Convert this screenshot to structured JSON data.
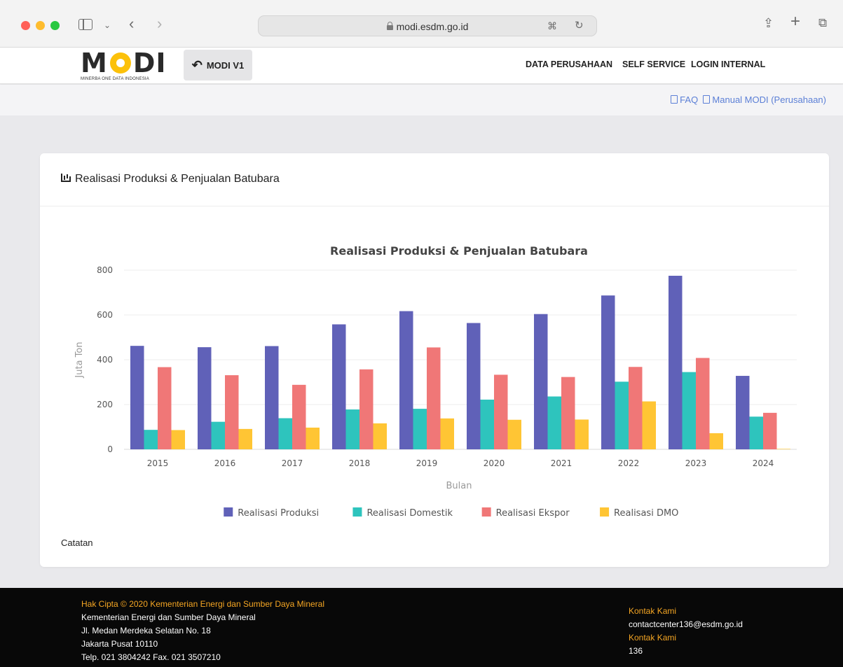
{
  "browser": {
    "url": "modi.esdm.go.id"
  },
  "header": {
    "logo_text": "MODI",
    "logo_subtitle": "MINERBA ONE DATA INDONESIA",
    "modi_v1_label": "MODI V1",
    "nav": [
      "DATA PERUSAHAAN",
      "SELF SERVICE",
      "LOGIN INTERNAL"
    ]
  },
  "links": {
    "faq": "FAQ",
    "manual": "Manual MODI (Perusahaan)"
  },
  "card": {
    "title": "Realisasi Produksi & Penjualan Batubara",
    "note": "Catatan"
  },
  "chart_data": {
    "type": "bar",
    "title": "Realisasi Produksi & Penjualan Batubara",
    "xlabel": "Bulan",
    "ylabel": "Juta Ton",
    "ylim": [
      0,
      800
    ],
    "yticks": [
      0,
      200,
      400,
      600,
      800
    ],
    "grid": true,
    "legend": "bottom",
    "categories": [
      "2015",
      "2016",
      "2017",
      "2018",
      "2019",
      "2020",
      "2021",
      "2022",
      "2023",
      "2024"
    ],
    "series": [
      {
        "name": "Realisasi Produksi",
        "color": "#6061b8",
        "values": [
          462,
          456,
          461,
          558,
          617,
          564,
          604,
          687,
          775,
          328
        ]
      },
      {
        "name": "Realisasi Domestik",
        "color": "#2ec4bd",
        "values": [
          87,
          123,
          139,
          178,
          181,
          222,
          236,
          302,
          345,
          146
        ]
      },
      {
        "name": "Realisasi Ekspor",
        "color": "#f07777",
        "values": [
          367,
          331,
          288,
          357,
          455,
          333,
          323,
          368,
          408,
          163
        ]
      },
      {
        "name": "Realisasi DMO",
        "color": "#ffc534",
        "values": [
          86,
          91,
          97,
          116,
          138,
          132,
          133,
          214,
          72,
          2
        ]
      }
    ]
  },
  "footer": {
    "copyright": "Hak Cipta © 2020 Kementerian Energi dan Sumber Daya Mineral",
    "org": "Kementerian Energi dan Sumber Daya Mineral",
    "address1": "Jl. Medan Merdeka Selatan No. 18",
    "address2": "Jakarta Pusat 10110",
    "phone": "Telp. 021 3804242 Fax. 021 3507210",
    "contact_label_1": "Kontak Kami",
    "contact_email": "contactcenter136@esdm.go.id",
    "contact_label_2": "Kontak Kami",
    "contact_phone": "136"
  }
}
